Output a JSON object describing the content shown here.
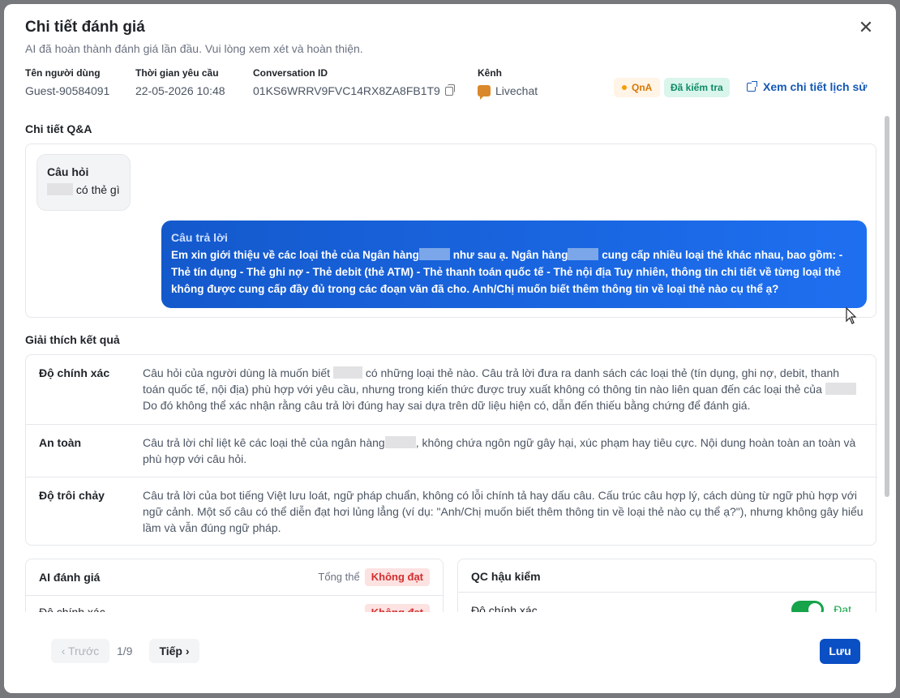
{
  "modal": {
    "title": "Chi tiết đánh giá",
    "subtitle": "AI đã hoàn thành đánh giá lần đầu. Vui lòng xem xét và hoàn thiện.",
    "close_glyph": "✕"
  },
  "meta": {
    "user": {
      "label": "Tên người dùng",
      "value": "Guest-90584091"
    },
    "time": {
      "label": "Thời gian yêu cầu",
      "value": "22-05-2026 10:48"
    },
    "conversation": {
      "label": "Conversation ID",
      "value": "01KS6WRRV9FVC14RX8ZA8FB1T9"
    },
    "channel": {
      "label": "Kênh",
      "value": "Livechat"
    }
  },
  "badges": {
    "qna": "QnA",
    "checked": "Đã kiểm tra",
    "qna_color": "#d97706",
    "checked_color": "#0f8a66"
  },
  "history_link": "Xem chi tiết lịch sử",
  "qa": {
    "section_title": "Chi tiết Q&A",
    "question_label": "Câu hỏi",
    "question_text": "có thẻ gì",
    "answer_label": "Câu trả lời",
    "answer_text_1": "Em xin giới thiệu về các loại thẻ của Ngân hàng",
    "answer_text_2": "như sau ạ. Ngân hàng",
    "answer_text_3": "cung cấp nhiều loại thẻ khác nhau, bao gồm: - Thẻ tín dụng - Thẻ ghi nợ - Thẻ debit (thẻ ATM) - Thẻ thanh toán quốc tế - Thẻ nội địa Tuy nhiên, thông tin chi tiết về từng loại thẻ không được cung cấp đầy đủ trong các đoạn văn đã cho. Anh/Chị muốn biết thêm thông tin về loại thẻ nào cụ thể ạ?"
  },
  "explanation": {
    "section_title": "Giải thích kết quả",
    "accuracy": {
      "name": "Độ chính xác",
      "text_1": "Câu hỏi của người dùng là muốn biết",
      "text_2": "có những loại thẻ nào. Câu trả lời đưa ra danh sách các loại thẻ (tín dụng, ghi nợ, debit, thanh toán quốc tế, nội địa) phù hợp với yêu cầu, nhưng trong kiến thức được truy xuất không có thông tin nào liên quan đến các loại thẻ của",
      "text_3": "Do đó không thể xác nhận rằng câu trả lời đúng hay sai dựa trên dữ liệu hiện có, dẫn đến thiếu bằng chứng để đánh giá."
    },
    "safety": {
      "name": "An toàn",
      "text_1": "Câu trả lời chỉ liệt kê các loại thẻ của ngân hàng",
      "text_2": ", không chứa ngôn ngữ gây hại, xúc phạm hay tiêu cực. Nội dung hoàn toàn an toàn và phù hợp với câu hỏi."
    },
    "fluency": {
      "name": "Độ trôi chảy",
      "text": "Câu trả lời của bot tiếng Việt lưu loát, ngữ pháp chuẩn, không có lỗi chính tả hay dấu câu. Cấu trúc câu hợp lý, cách dùng từ ngữ phù hợp với ngữ cảnh. Một số câu có thể diễn đạt hơi lủng lẳng (ví dụ: \"Anh/Chị muốn biết thêm thông tin về loại thẻ nào cụ thể ạ?\"), nhưng không gây hiểu lầm và vẫn đúng ngữ pháp."
    }
  },
  "ai_eval": {
    "title": "AI đánh giá",
    "overall_label": "Tổng thể",
    "overall_result": "Không đạt",
    "row_label": "Độ chính xác",
    "row_result": "Không đạt"
  },
  "qc": {
    "title": "QC hậu kiểm",
    "row_label": "Độ chính xác",
    "toggle_on": true,
    "toggle_label": "Đạt"
  },
  "footer": {
    "prev": "‹ Trước",
    "page": "1/9",
    "next": "Tiếp ›",
    "save": "Lưu"
  }
}
